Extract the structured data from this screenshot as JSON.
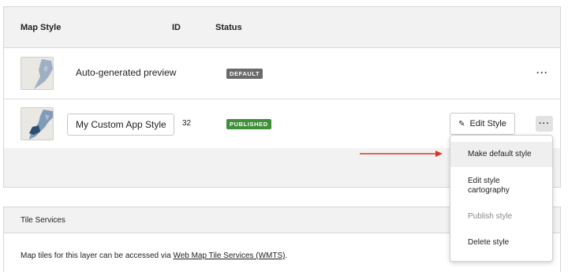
{
  "table": {
    "headers": {
      "map_style": "Map Style",
      "id": "ID",
      "status": "Status"
    },
    "rows": [
      {
        "name": "Auto-generated preview",
        "id": "",
        "status": "DEFAULT",
        "thumbnail": "map-thumbnail-icon"
      },
      {
        "name": "My Custom App Style",
        "id": "32",
        "status": "PUBLISHED",
        "thumbnail": "map-thumbnail-icon"
      }
    ]
  },
  "actions": {
    "edit_label": "Edit Style",
    "more_label": "···"
  },
  "menu": {
    "items": [
      "Make default style",
      "Edit style cartography",
      "Publish style",
      "Delete style"
    ]
  },
  "tile_services": {
    "title": "Tile Services",
    "text": "Map tiles for this layer can be accessed via ",
    "link": "Web Map Tile Services (WMTS)",
    "suffix": "."
  },
  "colors": {
    "default_badge": "#6a6a6a",
    "published_badge": "#3f8f3a",
    "arrow": "#d9342b"
  }
}
